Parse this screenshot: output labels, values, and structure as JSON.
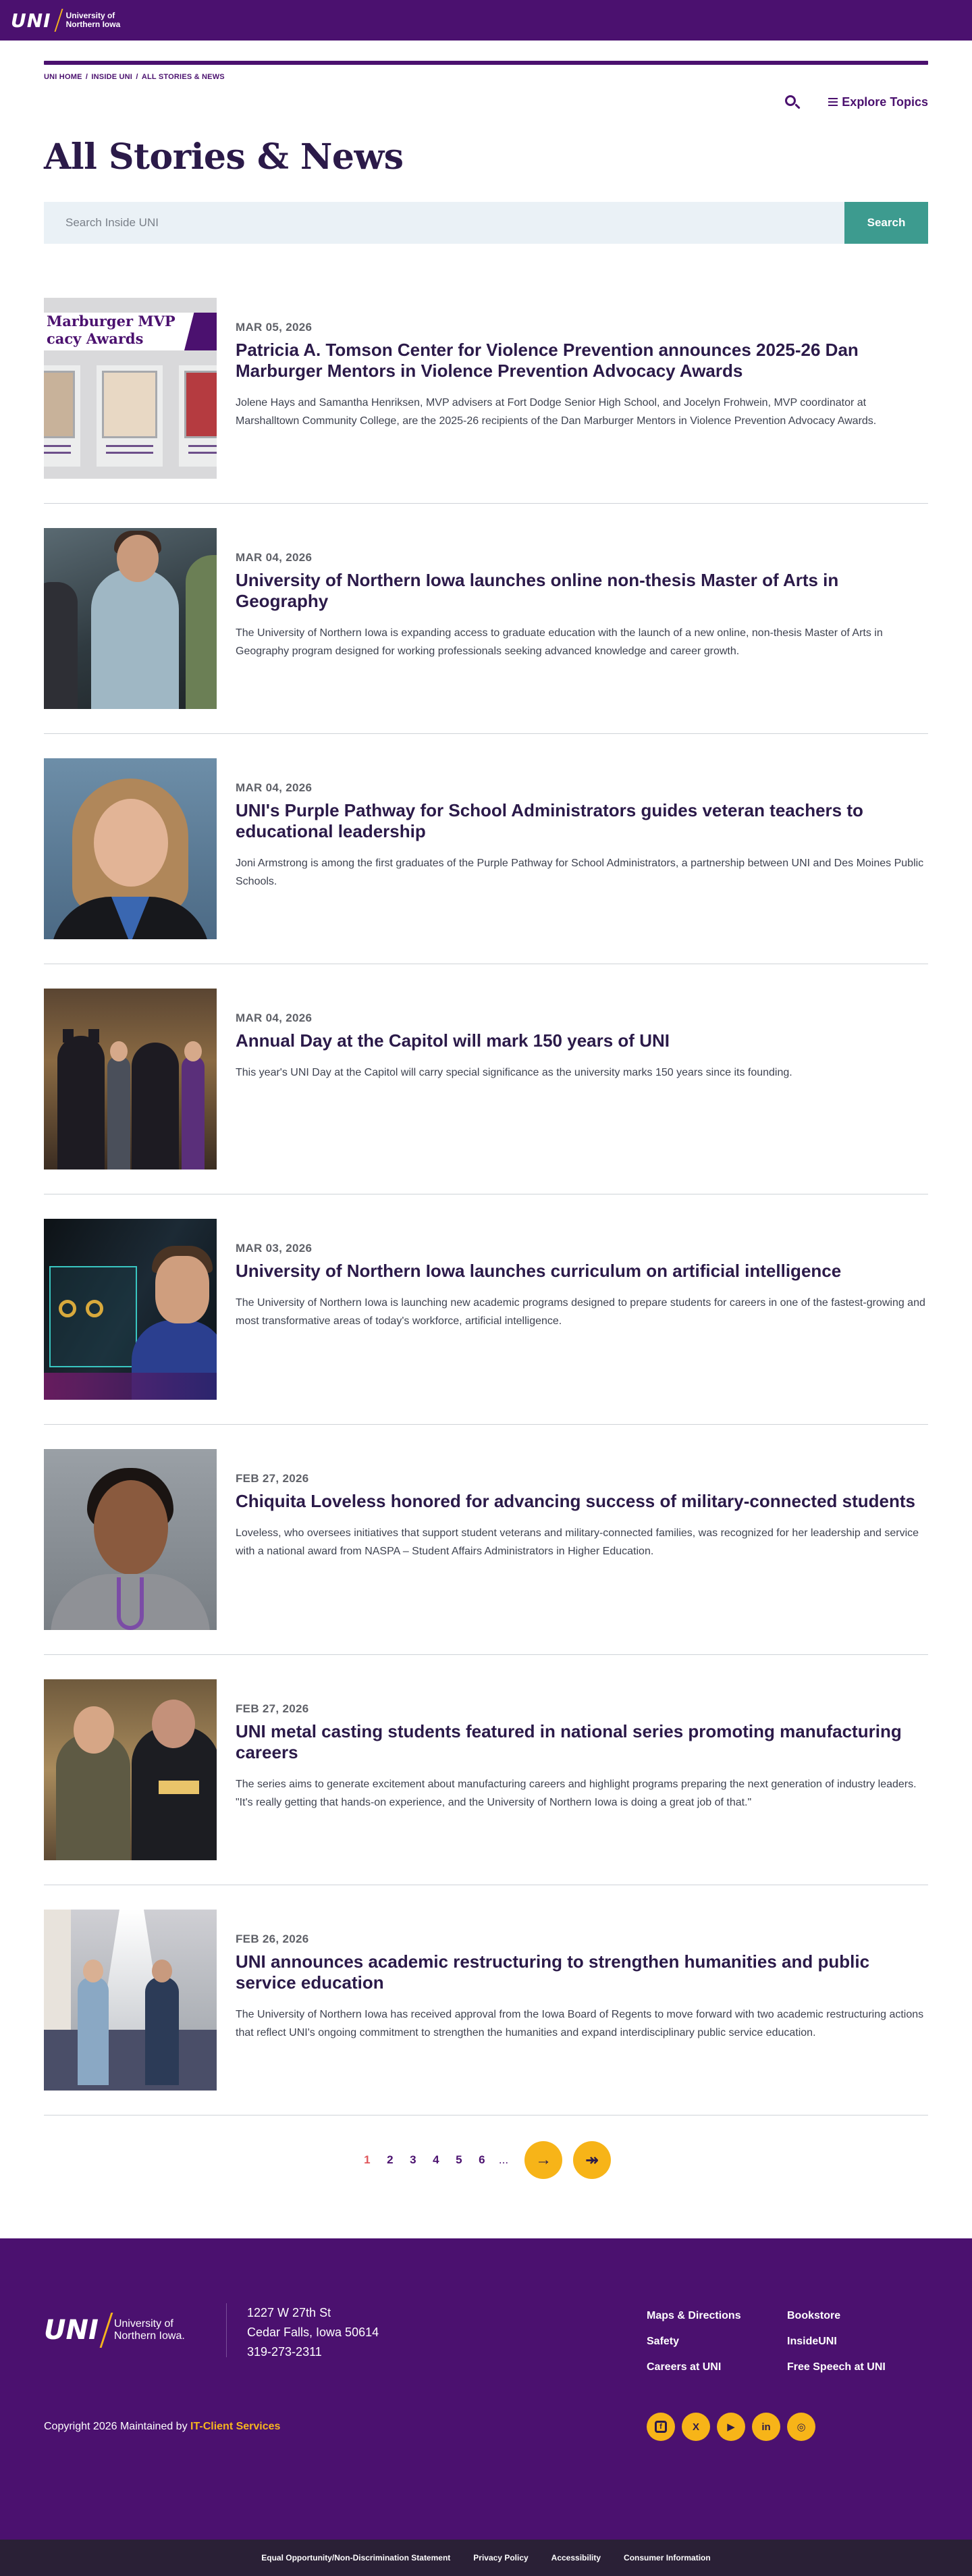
{
  "header": {
    "logo_mark": "UNI",
    "logo_line1": "University of",
    "logo_line2": "Northern Iowa"
  },
  "breadcrumb": [
    "UNI HOME",
    "INSIDE UNI",
    "ALL STORIES & NEWS"
  ],
  "utility": {
    "explore_label": "Explore Topics"
  },
  "page_title": "All Stories & News",
  "search": {
    "placeholder": "Search Inside UNI",
    "button_label": "Search"
  },
  "stories": [
    {
      "date": "MAR 05, 2026",
      "headline": "Patricia A. Tomson Center for Violence Prevention announces 2025-26 Dan Marburger Mentors in Violence Prevention Advocacy Awards",
      "summary": "Jolene Hays and Samantha Henriksen, MVP advisers at Fort Dodge Senior High School, and Jocelyn Frohwein, MVP coordinator at Marshalltown Community College, are the 2025-26 recipients of the Dan Marburger Mentors in Violence Prevention Advocacy Awards.",
      "thumb_text": "Marburger MVP\ncacy Awards"
    },
    {
      "date": "MAR 04, 2026",
      "headline": "University of Northern Iowa launches online non-thesis Master of Arts in Geography",
      "summary": "The University of Northern Iowa is expanding access to graduate education with the launch of a new online, non-thesis Master of Arts in Geography program designed for working professionals seeking advanced knowledge and career growth."
    },
    {
      "date": "MAR 04, 2026",
      "headline": "UNI's Purple Pathway for School Administrators guides veteran teachers to educational leadership",
      "summary": "Joni Armstrong is among the first graduates of the Purple Pathway for School Administrators, a partnership between UNI and Des Moines Public Schools."
    },
    {
      "date": "MAR 04, 2026",
      "headline": "Annual Day at the Capitol will mark 150 years of UNI",
      "summary": "This year's UNI Day at the Capitol will carry special significance as the university marks 150 years since its founding."
    },
    {
      "date": "MAR 03, 2026",
      "headline": "University of Northern Iowa launches curriculum on artificial intelligence",
      "summary": "The University of Northern Iowa is launching new academic programs designed to prepare students for careers in one of the fastest-growing and most transformative areas of today's workforce, artificial intelligence."
    },
    {
      "date": "FEB 27, 2026",
      "headline": "Chiquita Loveless honored for advancing success of military-connected students",
      "summary": "Loveless, who oversees initiatives that support student veterans and military-connected families, was recognized for her leadership and service with a national award from NASPA – Student Affairs Administrators in Higher Education."
    },
    {
      "date": "FEB 27, 2026",
      "headline": "UNI metal casting students featured in national series promoting manufacturing careers",
      "summary": "The series aims to generate excitement about manufacturing careers and highlight programs preparing the next generation of industry leaders. \"It's really getting that hands-on experience, and the University of Northern Iowa is doing a great job of that.\""
    },
    {
      "date": "FEB 26, 2026",
      "headline": "UNI announces academic restructuring to strengthen humanities and public service education",
      "summary": "The University of Northern Iowa has received approval from the Iowa Board of Regents to move forward with two academic restructuring actions that reflect UNI's ongoing commitment to strengthen the humanities and expand interdisciplinary public service education."
    }
  ],
  "pagination": {
    "pages": [
      "1",
      "2",
      "3",
      "4",
      "5",
      "6"
    ],
    "current": "1",
    "ellipsis": "...",
    "next_icon": "→",
    "last_icon": "↠"
  },
  "footer": {
    "logo_mark": "UNI",
    "logo_line1": "University of",
    "logo_line2": "Northern Iowa.",
    "address_line1": "1227 W 27th St",
    "address_line2": "Cedar Falls, Iowa 50614",
    "phone": "319-273-2311",
    "links": [
      "Maps & Directions",
      "Bookstore",
      "Safety",
      "InsideUNI",
      "Careers at UNI",
      "Free Speech at UNI"
    ],
    "copyright_prefix": "Copyright 2026 Maintained by ",
    "copyright_link": "IT-Client Services",
    "social": [
      {
        "name": "facebook-icon",
        "glyph": "f"
      },
      {
        "name": "x-icon",
        "glyph": "X"
      },
      {
        "name": "youtube-icon",
        "glyph": "▶"
      },
      {
        "name": "linkedin-icon",
        "glyph": "in"
      },
      {
        "name": "instagram-icon",
        "glyph": "◎"
      }
    ]
  },
  "bottom_links": [
    "Equal Opportunity/Non-Discrimination Statement",
    "Privacy Policy",
    "Accessibility",
    "Consumer Information"
  ],
  "colors": {
    "brand_purple": "#4b116f",
    "accent_gold": "#f7b418",
    "search_teal": "#3d9b8f"
  }
}
